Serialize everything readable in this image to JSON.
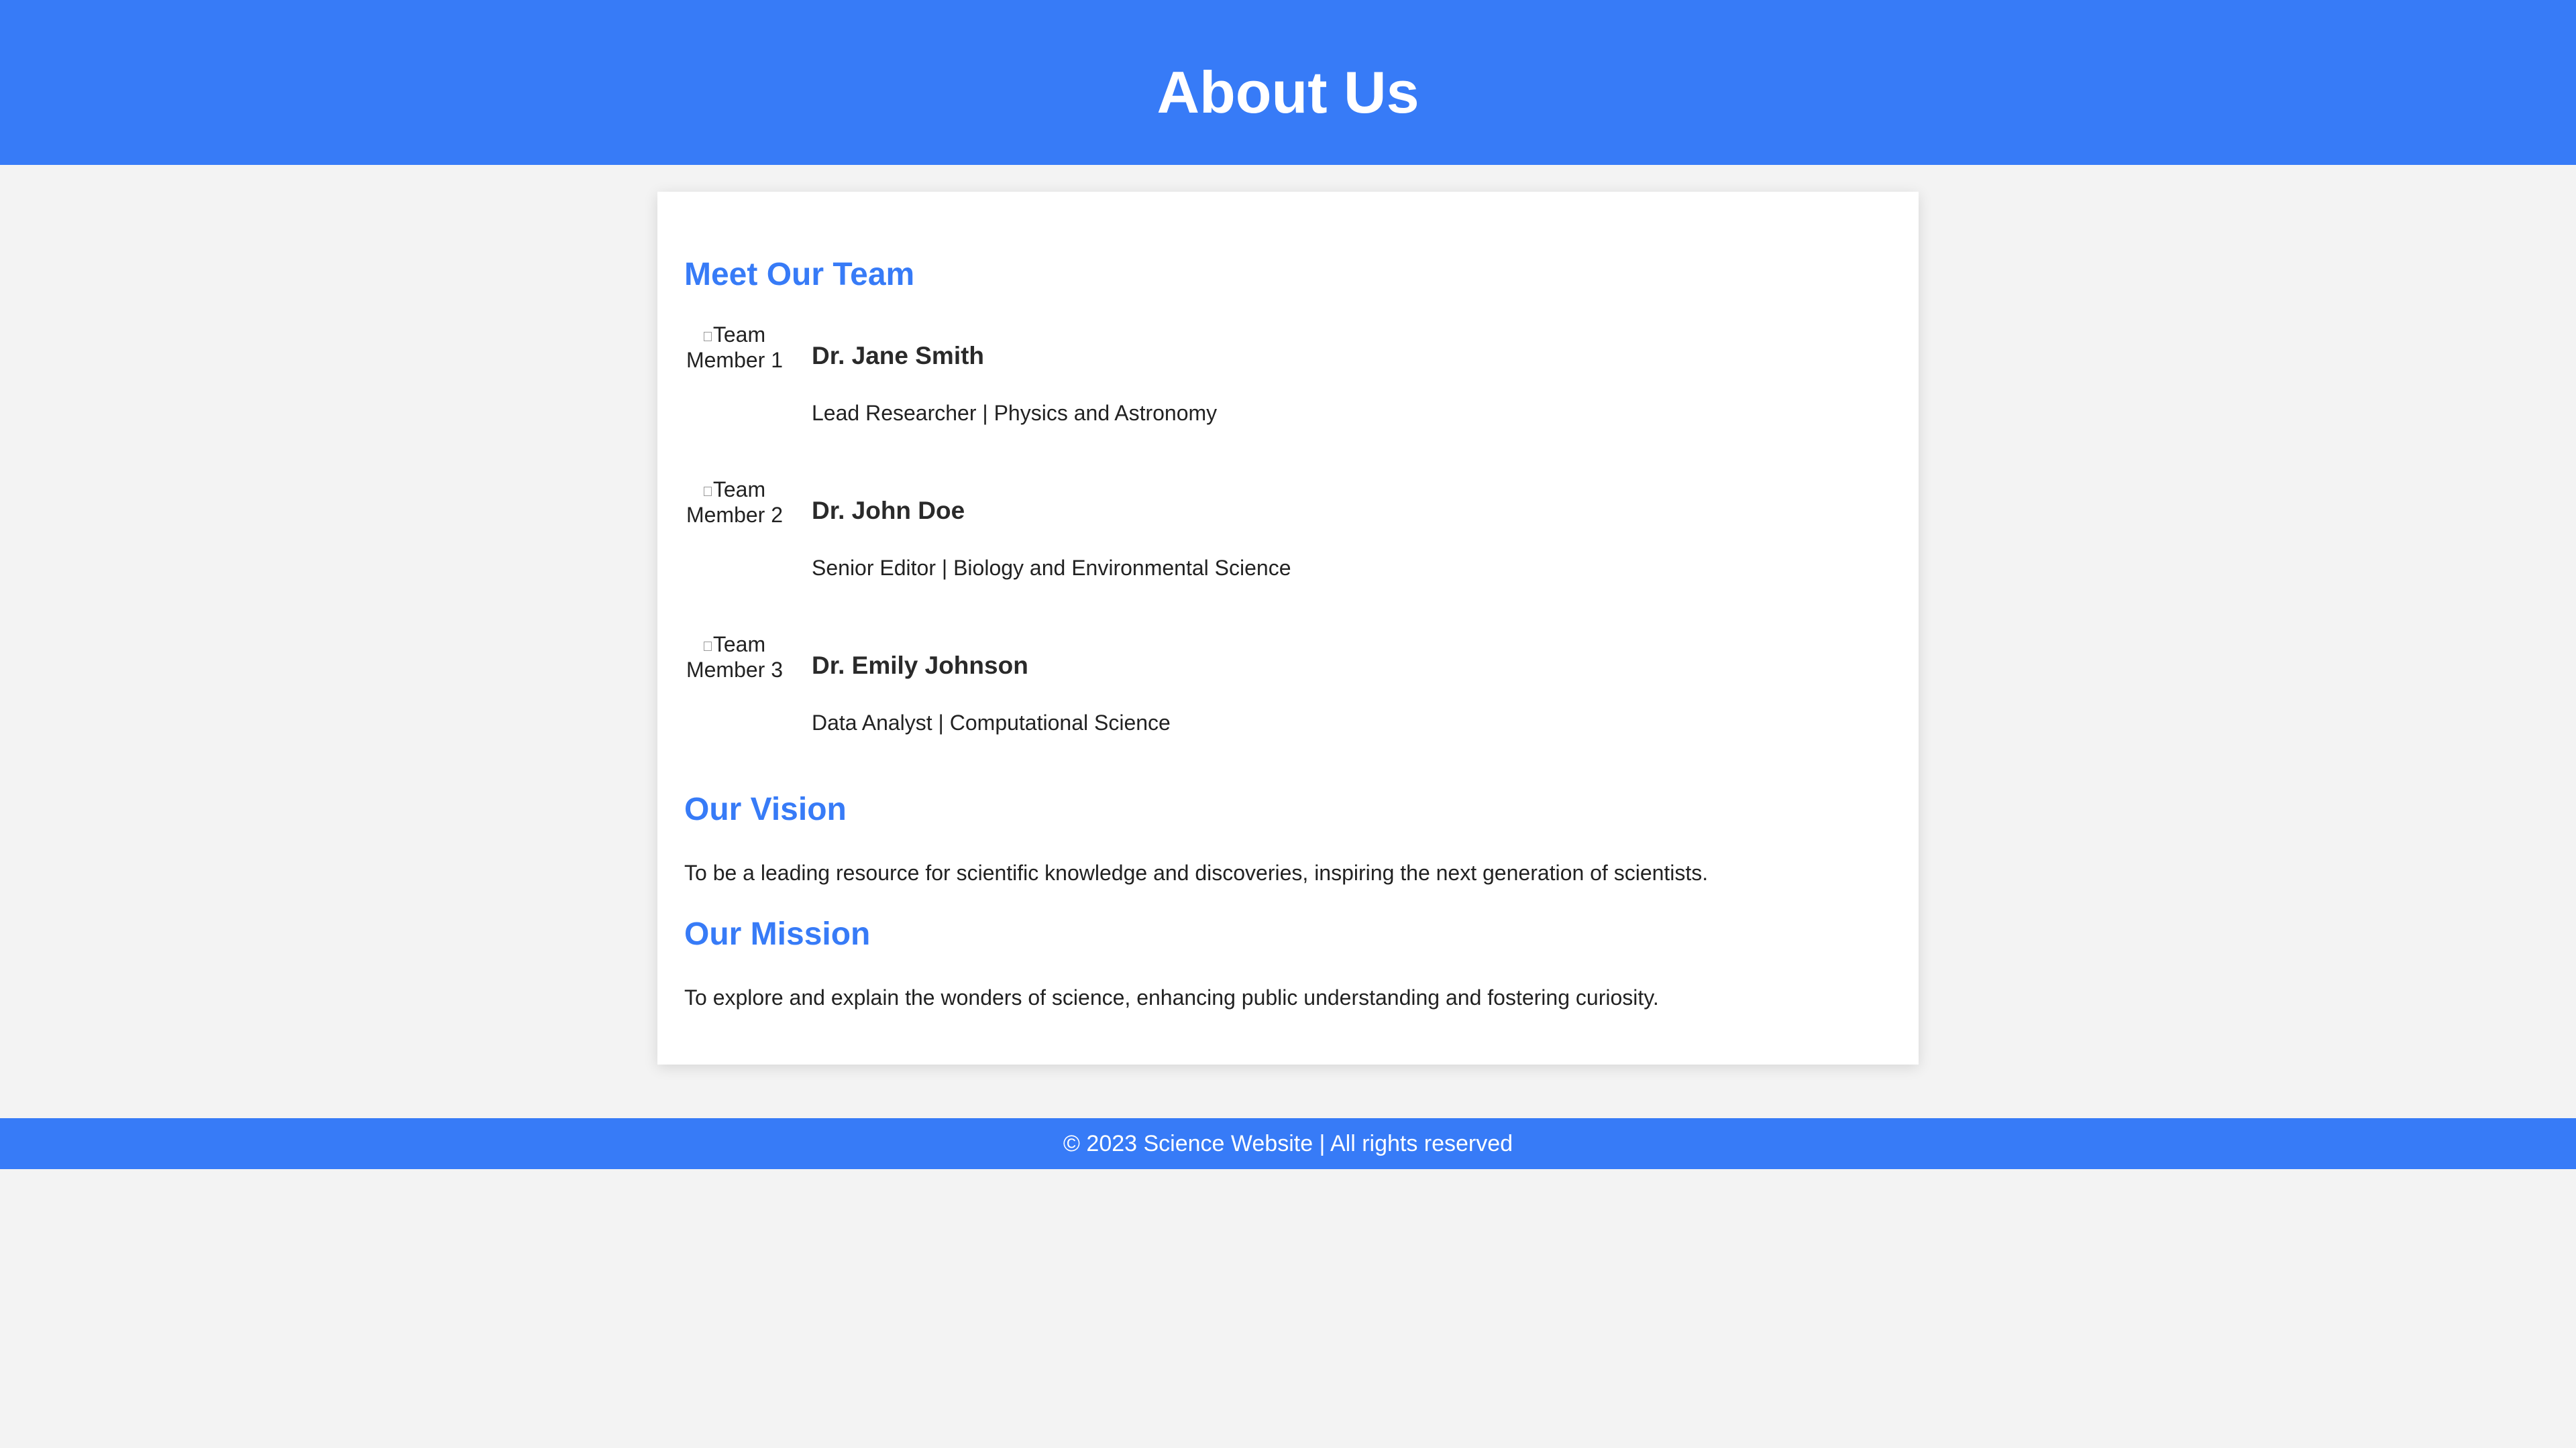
{
  "header": {
    "title": "About Us"
  },
  "team": {
    "heading": "Meet Our Team",
    "members": [
      {
        "image_alt": "Team Member 1",
        "name": "Dr. Jane Smith",
        "role": "Lead Researcher | Physics and Astronomy"
      },
      {
        "image_alt": "Team Member 2",
        "name": "Dr. John Doe",
        "role": "Senior Editor | Biology and Environmental Science"
      },
      {
        "image_alt": "Team Member 3",
        "name": "Dr. Emily Johnson",
        "role": "Data Analyst | Computational Science"
      }
    ]
  },
  "vision": {
    "heading": "Our Vision",
    "text": "To be a leading resource for scientific knowledge and discoveries, inspiring the next generation of scientists."
  },
  "mission": {
    "heading": "Our Mission",
    "text": "To explore and explain the wonders of science, enhancing public understanding and fostering curiosity."
  },
  "footer": {
    "text": "© 2023 Science Website | All rights reserved"
  },
  "colors": {
    "accent": "#377bf7",
    "background": "#f3f3f3",
    "card": "#ffffff"
  }
}
